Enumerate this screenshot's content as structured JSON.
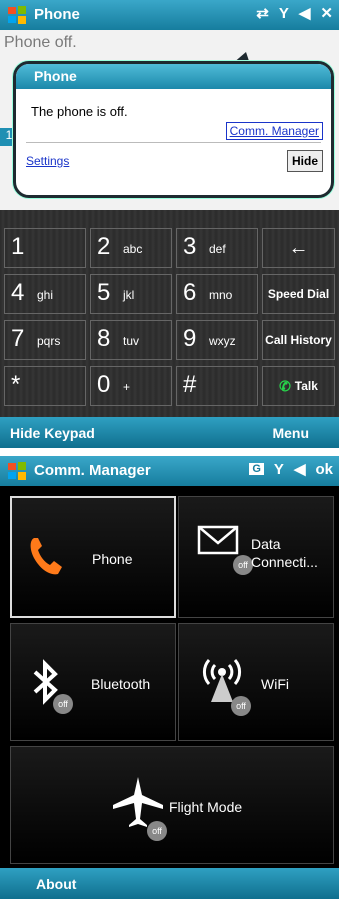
{
  "screen1": {
    "titlebar": {
      "title": "Phone",
      "close": "✕"
    },
    "background_text": "Phone off.",
    "notification": {
      "header": "Phone",
      "message": "The phone is off.",
      "comm_manager_link": "Comm. Manager",
      "settings_link": "Settings",
      "hide_button": "Hide"
    },
    "keypad": {
      "keys": [
        {
          "num": "1",
          "letters": ""
        },
        {
          "num": "2",
          "letters": "abc"
        },
        {
          "num": "3",
          "letters": "def"
        },
        {
          "num": "4",
          "letters": "ghi"
        },
        {
          "num": "5",
          "letters": "jkl"
        },
        {
          "num": "6",
          "letters": "mno"
        },
        {
          "num": "7",
          "letters": "pqrs"
        },
        {
          "num": "8",
          "letters": "tuv"
        },
        {
          "num": "9",
          "letters": "wxyz"
        },
        {
          "num": "*",
          "letters": ""
        },
        {
          "num": "0",
          "letters": "+"
        },
        {
          "num": "#",
          "letters": ""
        }
      ],
      "backspace": "←",
      "speed_dial": "Speed Dial",
      "call_history": "Call History",
      "talk": "Talk"
    },
    "softkeys": {
      "left": "Hide Keypad",
      "right": "Menu"
    }
  },
  "screen2": {
    "titlebar": {
      "title": "Comm. Manager",
      "ok": "ok",
      "g_badge": "G"
    },
    "tiles": {
      "phone": "Phone",
      "data": "Data Connecti...",
      "bluetooth": "Bluetooth",
      "wifi": "WiFi",
      "flight": "Flight Mode",
      "off": "off"
    },
    "softkeys": {
      "left": "About"
    }
  },
  "colors": {
    "titlebar": "#1f8fb3",
    "link": "#1a34c9",
    "talk": "#27d34a",
    "phone_icon": "#ff7a1a"
  }
}
